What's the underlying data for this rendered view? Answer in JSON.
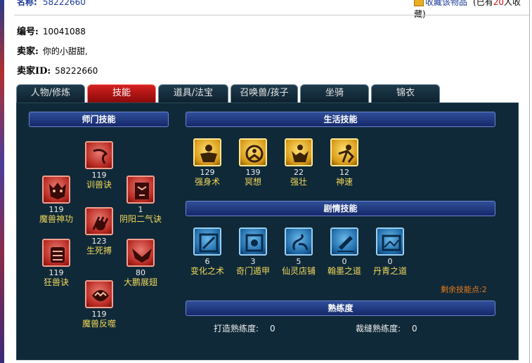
{
  "header": {
    "name_label": "名称:",
    "name_value": "58222660",
    "favorite_label": "收藏该物品",
    "favorite_count_prefix": "(已有",
    "favorite_count": "20",
    "favorite_count_suffix": "人收藏)"
  },
  "info": {
    "id_label": "编号:",
    "id_value": "10041088",
    "seller_label": "卖家:",
    "seller_value": "你的小甜甜,",
    "seller_id_label": "卖家ID:",
    "seller_id_value": "58222660"
  },
  "tabs": [
    {
      "label": "人物/修炼"
    },
    {
      "label": "技能"
    },
    {
      "label": "道具/法宝"
    },
    {
      "label": "召唤兽/孩子"
    },
    {
      "label": "坐骑"
    },
    {
      "label": "锦衣"
    }
  ],
  "active_tab": "技能",
  "sections": {
    "school": "师门技能",
    "life": "生活技能",
    "story": "剧情技能",
    "proficiency": "熟练度"
  },
  "school_skills": [
    {
      "name": "训兽诀",
      "level": "119",
      "icon": "whip-icon"
    },
    {
      "name": "魔兽神功",
      "level": "119",
      "icon": "demon-beast-icon"
    },
    {
      "name": "阴阳二气诀",
      "level": "1",
      "icon": "yinyang-mask-icon"
    },
    {
      "name": "生死搏",
      "level": "123",
      "icon": "claw-icon"
    },
    {
      "name": "狂兽诀",
      "level": "119",
      "icon": "beast-face-icon"
    },
    {
      "name": "大鹏展翅",
      "level": "80",
      "icon": "wings-icon"
    },
    {
      "name": "魔兽反噬",
      "level": "119",
      "icon": "bite-icon"
    }
  ],
  "life_skills": [
    {
      "name": "强身术",
      "level": "129",
      "icon": "strong-body-icon"
    },
    {
      "name": "冥想",
      "level": "139",
      "icon": "meditation-icon"
    },
    {
      "name": "强壮",
      "level": "22",
      "icon": "muscle-icon"
    },
    {
      "name": "神速",
      "level": "12",
      "icon": "speed-icon"
    }
  ],
  "story_skills": [
    {
      "name": "变化之术",
      "level": "6",
      "icon": "transform-icon"
    },
    {
      "name": "奇门遁甲",
      "level": "3",
      "icon": "rune-icon"
    },
    {
      "name": "仙灵店铺",
      "level": "5",
      "icon": "shop-icon"
    },
    {
      "name": "翰墨之道",
      "level": "0",
      "icon": "ink-icon"
    },
    {
      "name": "丹青之道",
      "level": "0",
      "icon": "painting-icon"
    }
  ],
  "remaining_points_label": "剩余技能点:",
  "remaining_points": "2",
  "proficiency": {
    "forge_label": "打造熟练度:",
    "forge_value": "0",
    "tailor_label": "裁缝熟练度:",
    "tailor_value": "0"
  },
  "colors": {
    "panel_bg": "#102938",
    "active_tab": "#c01818",
    "skill_name": "#f0d85a",
    "remaining_points": "#e87a1a"
  }
}
